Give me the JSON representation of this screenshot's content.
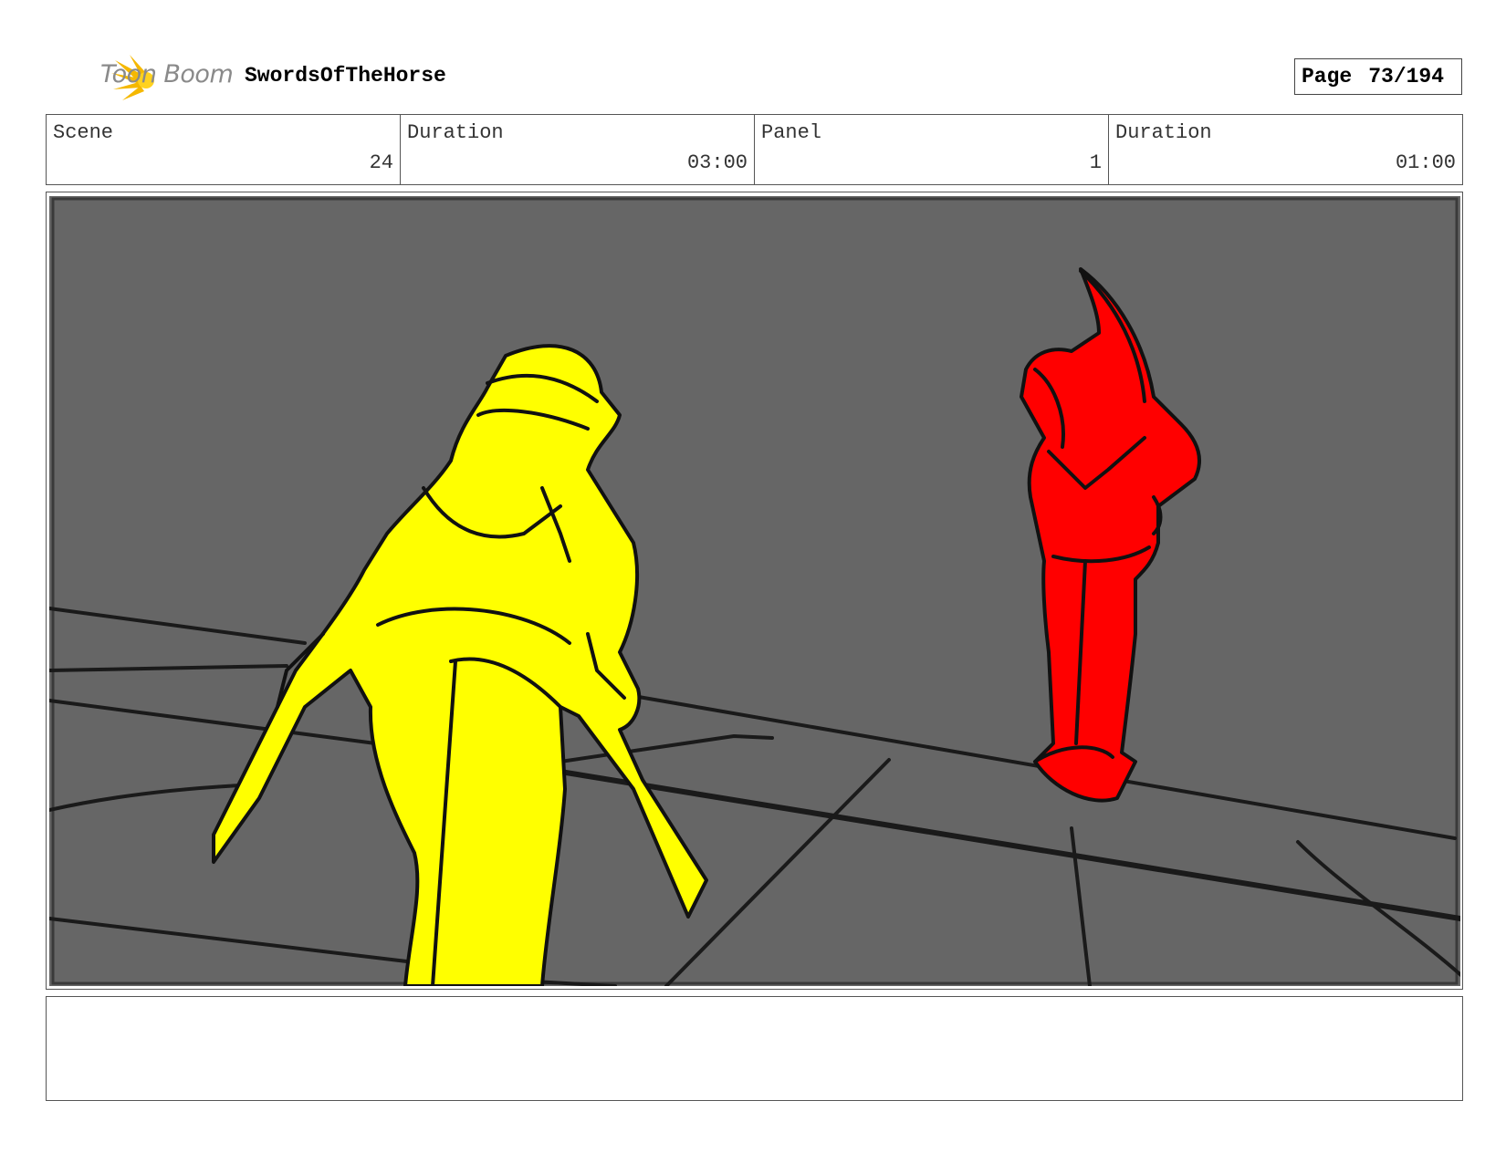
{
  "header": {
    "logo_text": "Toon Boom",
    "project_title": "SwordsOfTheHorse",
    "page_label": "Page",
    "page_value": "73/194"
  },
  "info": {
    "scene_label": "Scene",
    "scene_value": "24",
    "scene_duration_label": "Duration",
    "scene_duration_value": "03:00",
    "panel_label": "Panel",
    "panel_value": "1",
    "panel_duration_label": "Duration",
    "panel_duration_value": "01:00"
  },
  "colors": {
    "background": "#666666",
    "figure_left": "#ffff00",
    "figure_right": "#ff0000",
    "logo_accent": "#f5b800"
  },
  "caption": ""
}
